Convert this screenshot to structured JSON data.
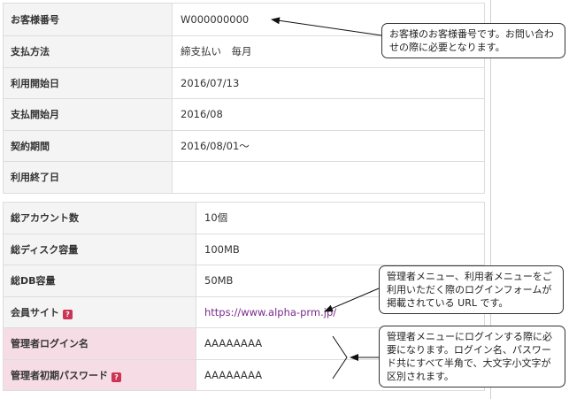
{
  "contract_table": {
    "rows": [
      {
        "label": "お客様番号",
        "value": "W000000000"
      },
      {
        "label": "支払方法",
        "value": "締支払い　毎月"
      },
      {
        "label": "利用開始日",
        "value": "2016/07/13"
      },
      {
        "label": "支払開始月",
        "value": "2016/08"
      },
      {
        "label": "契約期間",
        "value": "2016/08/01〜"
      },
      {
        "label": "利用終了日",
        "value": ""
      }
    ]
  },
  "account_table": {
    "rows": [
      {
        "label": "総アカウント数",
        "value": "10個"
      },
      {
        "label": "総ディスク容量",
        "value": "100MB"
      },
      {
        "label": "総DB容量",
        "value": "50MB"
      },
      {
        "label": "会員サイト",
        "value": "https://www.alpha-prm.jp/"
      },
      {
        "label": "管理者ログイン名",
        "value": "AAAAAAAA"
      },
      {
        "label": "管理者初期パスワード",
        "value": "AAAAAAAA"
      }
    ],
    "help_glyph": "?"
  },
  "callouts": {
    "customer_number": "お客様のお客様番号です。お問い合わせの際に必要となります。",
    "member_site": "管理者メニュー、利用者メニューをご利用いただく際のログインフォームが掲載されている URL です。",
    "login_credentials": "管理者メニューにログインする際に必要になります。ログイン名、パスワード共にすべて半角で、大文字小文字が区別されます。"
  },
  "colors": {
    "label_bg": "#f4f4f4",
    "label_highlight_bg": "#f6dce4",
    "link": "#7a2a8e",
    "help_badge": "#cc3355"
  }
}
